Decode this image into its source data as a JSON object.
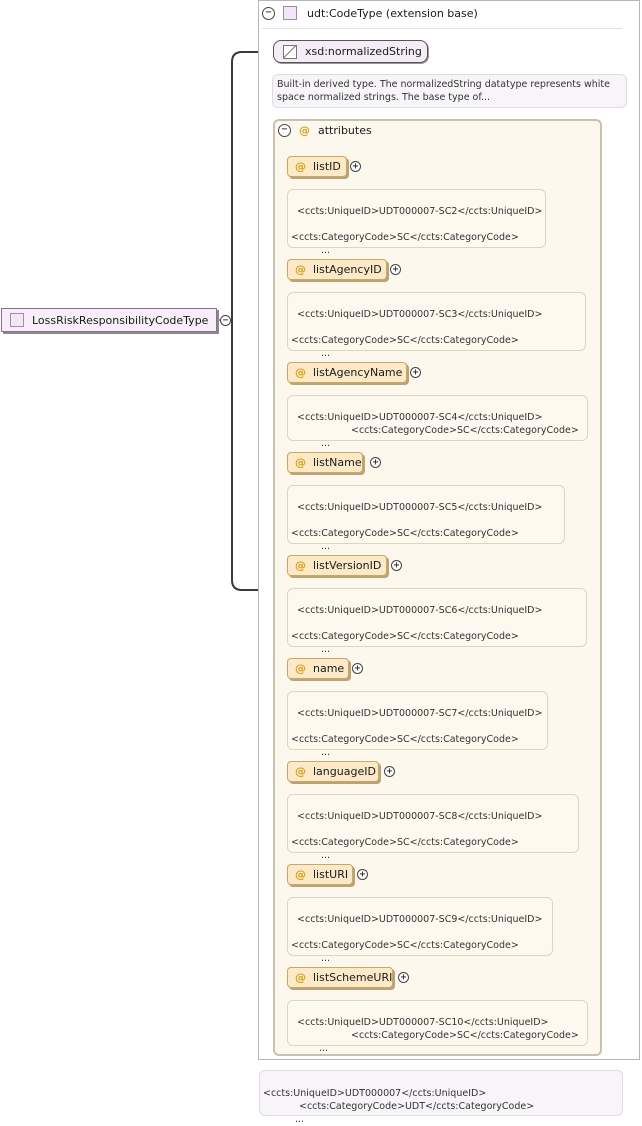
{
  "root": {
    "label": "LossRiskResponsibilityCodeType",
    "toggle": "−"
  },
  "type": {
    "label": "udt:CodeType (extension base)",
    "toggle": "−"
  },
  "base": {
    "label": "xsd:normalizedString"
  },
  "description": "Built-in derived type. The normalizedString datatype represents white space normalized strings. The base type of...",
  "attributes": {
    "label": "attributes",
    "toggle": "−",
    "at_symbol": "@",
    "items": [
      {
        "name": "listID",
        "toggle": "+",
        "line1": "<ccts:UniqueID>UDT000007-SC2</ccts:UniqueID>",
        "line2": "<ccts:CategoryCode>SC</ccts:CategoryCode>",
        "dots": "..."
      },
      {
        "name": "listAgencyID",
        "toggle": "+",
        "line1": "<ccts:UniqueID>UDT000007-SC3</ccts:UniqueID>",
        "line2": "<ccts:CategoryCode>SC</ccts:CategoryCode>",
        "dots": "..."
      },
      {
        "name": "listAgencyName",
        "toggle": "+",
        "line1": "<ccts:UniqueID>UDT000007-SC4</ccts:UniqueID>",
        "line2": "<ccts:CategoryCode>SC</ccts:CategoryCode>",
        "dots": "..."
      },
      {
        "name": "listName",
        "toggle": "+",
        "line1": "<ccts:UniqueID>UDT000007-SC5</ccts:UniqueID>",
        "line2": "<ccts:CategoryCode>SC</ccts:CategoryCode>",
        "dots": "..."
      },
      {
        "name": "listVersionID",
        "toggle": "+",
        "line1": "<ccts:UniqueID>UDT000007-SC6</ccts:UniqueID>",
        "line2": "<ccts:CategoryCode>SC</ccts:CategoryCode>",
        "dots": "..."
      },
      {
        "name": "name",
        "toggle": "+",
        "line1": "<ccts:UniqueID>UDT000007-SC7</ccts:UniqueID>",
        "line2": "<ccts:CategoryCode>SC</ccts:CategoryCode>",
        "dots": "..."
      },
      {
        "name": "languageID",
        "toggle": "+",
        "line1": "<ccts:UniqueID>UDT000007-SC8</ccts:UniqueID>",
        "line2": "<ccts:CategoryCode>SC</ccts:CategoryCode>",
        "dots": "..."
      },
      {
        "name": "listURI",
        "toggle": "+",
        "line1": "<ccts:UniqueID>UDT000007-SC9</ccts:UniqueID>",
        "line2": "<ccts:CategoryCode>SC</ccts:CategoryCode>",
        "dots": "..."
      },
      {
        "name": "listSchemeURI",
        "toggle": "+",
        "line1": "<ccts:UniqueID>UDT000007-SC10</ccts:UniqueID>",
        "line2": "<ccts:CategoryCode>SC</ccts:CategoryCode>",
        "dots": "..."
      }
    ]
  },
  "bottom_note": {
    "line1": "<ccts:UniqueID>UDT000007</ccts:UniqueID>",
    "line2": "<ccts:CategoryCode>UDT</ccts:CategoryCode>",
    "dots": "..."
  }
}
